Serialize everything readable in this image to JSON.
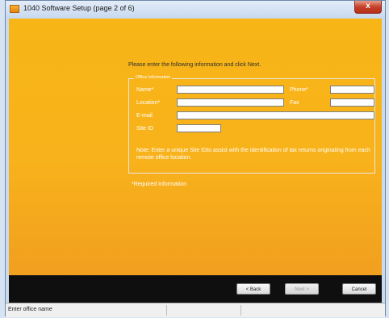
{
  "window": {
    "title": "1040 Software Setup (page 2 of 6)",
    "close_glyph": "x"
  },
  "form": {
    "prompt": "Please enter the following information and click Next.",
    "group_title": "Office Information",
    "name": {
      "label": "Name*",
      "value": ""
    },
    "phone": {
      "label": "Phone*",
      "value": ""
    },
    "location": {
      "label": "Location*",
      "value": ""
    },
    "fax": {
      "label": "Fax",
      "value": ""
    },
    "email": {
      "label": "E-mail",
      "value": ""
    },
    "site_id": {
      "label": "Site ID",
      "value": ""
    },
    "note": "Note: Enter a unique Site IDto assist with the identification of tax returns originating from each remote office location.",
    "required_note": "*Required Information"
  },
  "buttons": {
    "back": "< Back",
    "next": "Next >",
    "cancel": "Cancel"
  },
  "status": {
    "text": "Enter office name"
  },
  "colors": {
    "accent": "#f7b516",
    "bottom_bar": "#0f0f0f",
    "close": "#c5402a"
  },
  "icons": {
    "title": "app-installer-icon"
  }
}
